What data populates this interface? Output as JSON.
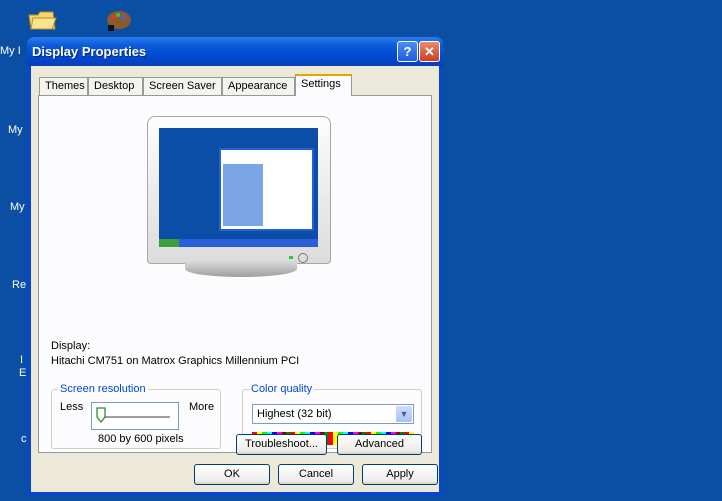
{
  "desktop": {
    "labels": [
      "My I",
      "My",
      "My",
      "Re",
      "I",
      "E",
      "c"
    ]
  },
  "window": {
    "title": "Display Properties",
    "help_glyph": "?",
    "close_glyph": "✕"
  },
  "tabs": [
    "Themes",
    "Desktop",
    "Screen Saver",
    "Appearance",
    "Settings"
  ],
  "display": {
    "label": "Display:",
    "value": "Hitachi CM751 on Matrox Graphics Millennium PCI"
  },
  "resolution": {
    "title": "Screen resolution",
    "less": "Less",
    "more": "More",
    "value": "800 by 600 pixels",
    "slider_level": 0
  },
  "color_quality": {
    "title": "Color quality",
    "selected": "Highest (32 bit)"
  },
  "buttons": {
    "troubleshoot": "Troubleshoot...",
    "advanced": "Advanced",
    "ok": "OK",
    "cancel": "Cancel",
    "apply": "Apply"
  },
  "colors": {
    "desktop": "#0a4fa3",
    "titlebar": "#0054e3",
    "dialog": "#ece9d8",
    "link_accent": "#0046d5"
  }
}
